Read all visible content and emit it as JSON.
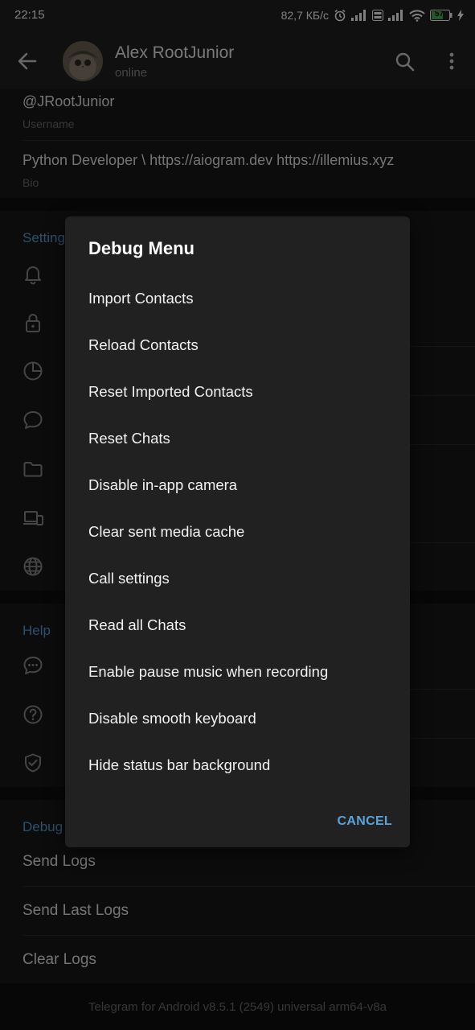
{
  "status_bar": {
    "time": "22:15",
    "network_speed": "82,7 КБ/с",
    "battery_level": "57",
    "icons": [
      "alarm-icon",
      "signal-icon",
      "volte-icon",
      "signal-icon",
      "wifi-icon",
      "battery-icon",
      "charging-icon"
    ]
  },
  "header": {
    "name": "Alex RootJunior",
    "status": "online",
    "icons": [
      "back-arrow-icon",
      "search-icon",
      "more-vertical-icon"
    ]
  },
  "profile_info": {
    "username_value": "@JRootJunior",
    "username_label": "Username",
    "bio_value": "Python Developer \\ https://aiogram.dev https://illemius.xyz",
    "bio_label": "Bio"
  },
  "settings_section": {
    "title": "Setting",
    "icons": [
      "bell-icon",
      "lock-icon",
      "pie-chart-icon",
      "chat-bubble-icon",
      "folder-icon",
      "devices-icon",
      "globe-icon"
    ]
  },
  "help_section": {
    "title": "Help",
    "icons": [
      "chat-dots-icon",
      "question-circle-icon",
      "shield-check-icon"
    ]
  },
  "debug_section": {
    "title": "Debug",
    "items": [
      "Send Logs",
      "Send Last Logs",
      "Clear Logs"
    ]
  },
  "footer": {
    "version": "Telegram for Android v8.5.1 (2549) universal arm64-v8a"
  },
  "dialog": {
    "title": "Debug Menu",
    "items": [
      "Import Contacts",
      "Reload Contacts",
      "Reset Imported Contacts",
      "Reset Chats",
      "Disable in-app camera",
      "Clear sent media cache",
      "Call settings",
      "Read all Chats",
      "Enable pause music when recording",
      "Disable smooth keyboard",
      "Hide status bar background"
    ],
    "cancel_label": "CANCEL"
  },
  "colors": {
    "accent": "#5aa2d8",
    "background": "#181818",
    "dialog_background": "#212121"
  }
}
